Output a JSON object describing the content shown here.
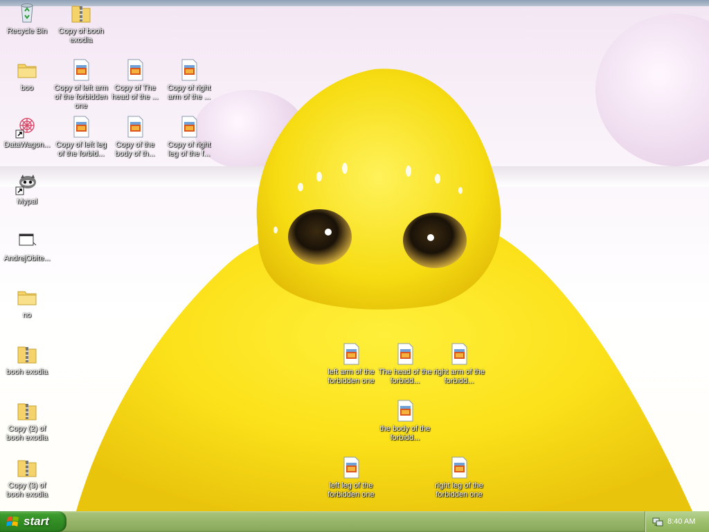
{
  "desktop": {
    "icons": [
      {
        "label": "Recycle Bin",
        "icon": "recycle-bin-icon"
      },
      {
        "label": "Copy of booh exodia",
        "icon": "zip-folder-icon"
      },
      {
        "label": "boo",
        "icon": "folder-icon"
      },
      {
        "label": "Copy of left arm of the forbidden one",
        "icon": "image-file-icon"
      },
      {
        "label": "Copy of The head of the ...",
        "icon": "image-file-icon"
      },
      {
        "label": "Copy of right arm of the ...",
        "icon": "image-file-icon"
      },
      {
        "label": "DataWagon...",
        "icon": "datawagon-shortcut-icon"
      },
      {
        "label": "Copy of left leg of the forbid...",
        "icon": "image-file-icon"
      },
      {
        "label": "Copy of the body of th...",
        "icon": "image-file-icon"
      },
      {
        "label": "Copy of right leg of the f...",
        "icon": "image-file-icon"
      },
      {
        "label": "Mypal",
        "icon": "mypal-shortcut-icon"
      },
      {
        "label": "AndrejObite...",
        "icon": "window-shortcut-icon"
      },
      {
        "label": "no",
        "icon": "folder-icon"
      },
      {
        "label": "booh exodia",
        "icon": "zip-folder-icon"
      },
      {
        "label": "Copy (2) of booh exodia",
        "icon": "zip-folder-icon"
      },
      {
        "label": "Copy (3) of booh exodia",
        "icon": "zip-folder-icon"
      },
      {
        "label": "left arm of the forbidden one",
        "icon": "image-file-icon"
      },
      {
        "label": "The head of the forbidd...",
        "icon": "image-file-icon"
      },
      {
        "label": "right arm of the forbidd...",
        "icon": "image-file-icon"
      },
      {
        "label": "the body of the forbidd...",
        "icon": "image-file-icon"
      },
      {
        "label": "left leg of the forbidden one",
        "icon": "image-file-icon"
      },
      {
        "label": "right leg of the forbidden one",
        "icon": "image-file-icon"
      }
    ]
  },
  "taskbar": {
    "start_label": "start",
    "clock": "8:40 AM"
  }
}
